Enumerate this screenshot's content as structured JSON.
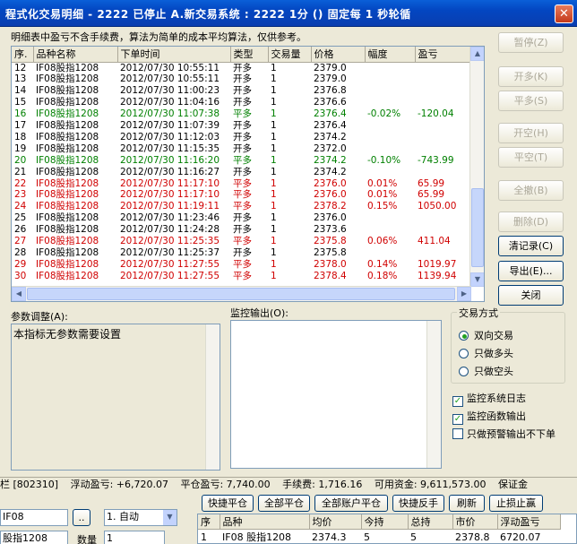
{
  "window": {
    "title": "程式化交易明细  - 2222 已停止  A.新交易系统 : 2222 1分 () 固定每 1 秒轮循",
    "close": "✕"
  },
  "note": "明细表中盈亏不含手续费，算法为简单的成本平均算法，仅供参考。",
  "trades": {
    "columns": [
      "序.",
      "品种名称",
      "下单时间",
      "类型",
      "交易量",
      "价格",
      "幅度",
      "盈亏"
    ],
    "rows": [
      {
        "seq": "12",
        "name": "IF08股指1208",
        "time": "2012/07/30 10:55:11",
        "type": "开多",
        "qty": "1",
        "price": "2379.0",
        "pct": "",
        "pnl": "",
        "color": "black"
      },
      {
        "seq": "13",
        "name": "IF08股指1208",
        "time": "2012/07/30 10:55:11",
        "type": "开多",
        "qty": "1",
        "price": "2379.0",
        "pct": "",
        "pnl": "",
        "color": "black"
      },
      {
        "seq": "14",
        "name": "IF08股指1208",
        "time": "2012/07/30 11:00:23",
        "type": "开多",
        "qty": "1",
        "price": "2376.8",
        "pct": "",
        "pnl": "",
        "color": "black"
      },
      {
        "seq": "15",
        "name": "IF08股指1208",
        "time": "2012/07/30 11:04:16",
        "type": "开多",
        "qty": "1",
        "price": "2376.6",
        "pct": "",
        "pnl": "",
        "color": "black"
      },
      {
        "seq": "16",
        "name": "IF08股指1208",
        "time": "2012/07/30 11:07:38",
        "type": "平多",
        "qty": "1",
        "price": "2376.4",
        "pct": "-0.02%",
        "pnl": "-120.04",
        "color": "green"
      },
      {
        "seq": "17",
        "name": "IF08股指1208",
        "time": "2012/07/30 11:07:39",
        "type": "开多",
        "qty": "1",
        "price": "2376.4",
        "pct": "",
        "pnl": "",
        "color": "black"
      },
      {
        "seq": "18",
        "name": "IF08股指1208",
        "time": "2012/07/30 11:12:03",
        "type": "开多",
        "qty": "1",
        "price": "2374.2",
        "pct": "",
        "pnl": "",
        "color": "black"
      },
      {
        "seq": "19",
        "name": "IF08股指1208",
        "time": "2012/07/30 11:15:35",
        "type": "开多",
        "qty": "1",
        "price": "2372.0",
        "pct": "",
        "pnl": "",
        "color": "black"
      },
      {
        "seq": "20",
        "name": "IF08股指1208",
        "time": "2012/07/30 11:16:20",
        "type": "平多",
        "qty": "1",
        "price": "2374.2",
        "pct": "-0.10%",
        "pnl": "-743.99",
        "color": "green"
      },
      {
        "seq": "21",
        "name": "IF08股指1208",
        "time": "2012/07/30 11:16:27",
        "type": "开多",
        "qty": "1",
        "price": "2374.2",
        "pct": "",
        "pnl": "",
        "color": "black"
      },
      {
        "seq": "22",
        "name": "IF08股指1208",
        "time": "2012/07/30 11:17:10",
        "type": "平多",
        "qty": "1",
        "price": "2376.0",
        "pct": "0.01%",
        "pnl": "65.99",
        "color": "red"
      },
      {
        "seq": "23",
        "name": "IF08股指1208",
        "time": "2012/07/30 11:17:10",
        "type": "平多",
        "qty": "1",
        "price": "2376.0",
        "pct": "0.01%",
        "pnl": "65.99",
        "color": "red"
      },
      {
        "seq": "24",
        "name": "IF08股指1208",
        "time": "2012/07/30 11:19:11",
        "type": "平多",
        "qty": "1",
        "price": "2378.2",
        "pct": "0.15%",
        "pnl": "1050.00",
        "color": "red"
      },
      {
        "seq": "25",
        "name": "IF08股指1208",
        "time": "2012/07/30 11:23:46",
        "type": "开多",
        "qty": "1",
        "price": "2376.0",
        "pct": "",
        "pnl": "",
        "color": "black"
      },
      {
        "seq": "26",
        "name": "IF08股指1208",
        "time": "2012/07/30 11:24:28",
        "type": "开多",
        "qty": "1",
        "price": "2373.6",
        "pct": "",
        "pnl": "",
        "color": "black"
      },
      {
        "seq": "27",
        "name": "IF08股指1208",
        "time": "2012/07/30 11:25:35",
        "type": "平多",
        "qty": "1",
        "price": "2375.8",
        "pct": "0.06%",
        "pnl": "411.04",
        "color": "red"
      },
      {
        "seq": "28",
        "name": "IF08股指1208",
        "time": "2012/07/30 11:25:37",
        "type": "开多",
        "qty": "1",
        "price": "2375.8",
        "pct": "",
        "pnl": "",
        "color": "black"
      },
      {
        "seq": "29",
        "name": "IF08股指1208",
        "time": "2012/07/30 11:27:55",
        "type": "平多",
        "qty": "1",
        "price": "2378.0",
        "pct": "0.14%",
        "pnl": "1019.97",
        "color": "red"
      },
      {
        "seq": "30",
        "name": "IF08股指1208",
        "time": "2012/07/30 11:27:55",
        "type": "平多",
        "qty": "1",
        "price": "2378.4",
        "pct": "0.18%",
        "pnl": "1139.94",
        "color": "red"
      }
    ]
  },
  "buttons": {
    "pause": "暂停(Z)",
    "open_long": "开多(K)",
    "close_long": "平多(S)",
    "open_short": "开空(H)",
    "close_short": "平空(T)",
    "cancel_all": "全撤(B)",
    "delete": "删除(D)",
    "clear_log": "清记录(C)",
    "export": "导出(E)...",
    "close": "关闭"
  },
  "params": {
    "label": "参数调整(A):",
    "text": "本指标无参数需要设置"
  },
  "monitor": {
    "label": "监控输出(O):"
  },
  "trade_mode": {
    "title": "交易方式",
    "options": [
      "双向交易",
      "只做多头",
      "只做空头"
    ],
    "selected_index": 0
  },
  "checks": [
    {
      "label": "监控系统日志",
      "checked": true
    },
    {
      "label": "监控函数输出",
      "checked": true
    },
    {
      "label": "只做预警输出不下单",
      "checked": false
    }
  ],
  "status": {
    "account": "栏 [802310]",
    "float_pnl": "浮动盈亏: +6,720.07",
    "close_pnl": "平仓盈亏: 7,740.00",
    "fee": "手续费: 1,716.16",
    "avail": "可用资金: 9,611,573.00",
    "margin": "保证金"
  },
  "bottom": {
    "contract": "IF08",
    "dots": "..",
    "mode": "1. 自动",
    "contract2": "股指1208",
    "qty_label": "数量",
    "qty": "1",
    "actions": [
      "快捷平仓",
      "全部平仓",
      "全部账户平仓",
      "快捷反手",
      "刷新",
      "止损止赢"
    ]
  },
  "positions": {
    "columns": [
      "序",
      "品种",
      "均价",
      "今持",
      "总持",
      "市价",
      "浮动盈亏"
    ],
    "rows": [
      {
        "seq": "1",
        "name": "IF08 股指1208",
        "avg": "2374.3",
        "today": "5",
        "total": "5",
        "market": "2378.8",
        "pnl": "6720.07"
      }
    ]
  }
}
